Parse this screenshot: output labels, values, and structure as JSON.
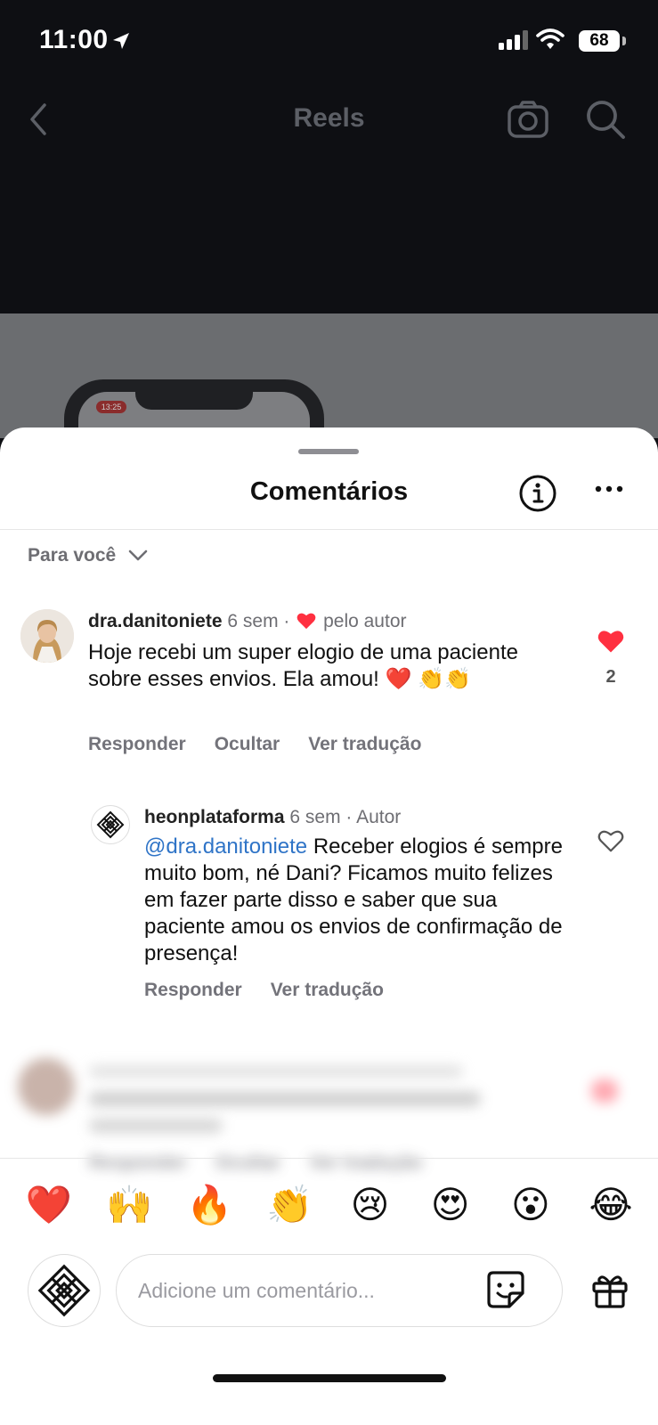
{
  "status_bar": {
    "time": "11:00",
    "battery": "68"
  },
  "header": {
    "title": "Reels"
  },
  "video": {
    "phone_time": "13:25"
  },
  "sheet": {
    "title": "Comentários",
    "sort_label": "Para você"
  },
  "comments": [
    {
      "username": "dra.danitoniete",
      "time": "6 sem",
      "separator": "·",
      "liked_by_author": "pelo autor",
      "text": "Hoje recebi um super elogio de uma paciente sobre esses envios. Ela amou! ❤️ 👏👏",
      "like_count": "2",
      "actions": [
        "Responder",
        "Ocultar",
        "Ver tradução"
      ]
    },
    {
      "username": "heonplataforma",
      "time": "6 sem",
      "separator": "·",
      "badge": "Autor",
      "mention": "@dra.danitoniete",
      "text": " Receber elogios é sempre muito bom, né Dani? Ficamos muito felizes em fazer parte disso e saber que sua paciente amou os envios de confirmação de presença!",
      "actions": [
        "Responder",
        "Ver tradução"
      ]
    }
  ],
  "blurred_comment": {
    "actions": [
      "Responder",
      "Ocultar",
      "Ver tradução"
    ]
  },
  "emoji_bar": [
    "❤️",
    "🙌",
    "🔥",
    "👏",
    "😢",
    "😍",
    "😮",
    "😂"
  ],
  "composer": {
    "placeholder": "Adicione um comentário..."
  },
  "colors": {
    "like_red": "#ff3040",
    "mention_blue": "#2f74c7"
  }
}
